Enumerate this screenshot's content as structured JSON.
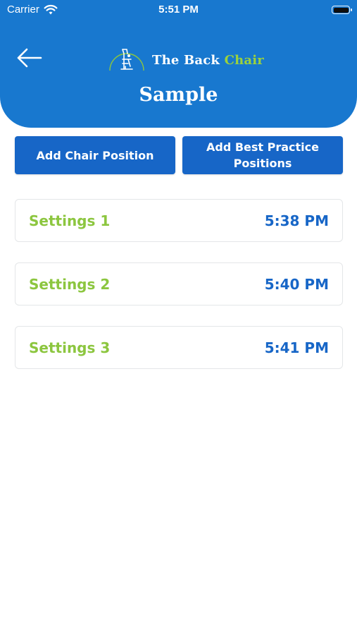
{
  "status_bar": {
    "carrier": "Carrier",
    "time": "5:51 PM",
    "icons": [
      "wifi-icon",
      "battery-icon"
    ]
  },
  "header": {
    "back_icon": "arrow-left-icon",
    "logo": {
      "text_main": "The Back ",
      "text_accent": "Chair"
    },
    "title": "Sample"
  },
  "actions": {
    "add_chair_position": "Add Chair Position",
    "add_best_practice": "Add Best Practice Positions"
  },
  "settings": [
    {
      "name": "Settings 1",
      "time": "5:38 PM"
    },
    {
      "name": "Settings 2",
      "time": "5:40 PM"
    },
    {
      "name": "Settings 3",
      "time": "5:41 PM"
    }
  ],
  "colors": {
    "header_bg": "#1878cf",
    "button_bg": "#1766c7",
    "setting_name": "#8cc63f",
    "setting_time": "#1766c7",
    "logo_accent": "#9cd23c"
  }
}
